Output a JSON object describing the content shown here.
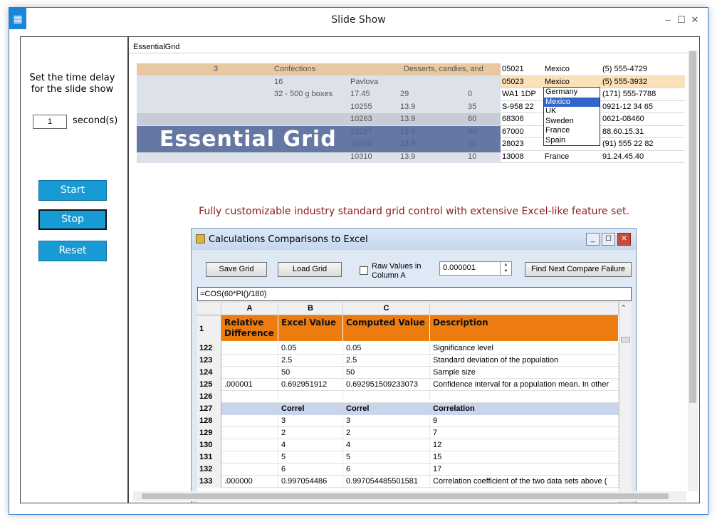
{
  "window": {
    "title": "Slide Show",
    "minimize": "–",
    "maximize": "☐",
    "close": "✕",
    "app_icon": "▦"
  },
  "left": {
    "delay_text": "Set the time delay for the slide show",
    "seconds_value": "1",
    "seconds_label": "second(s)",
    "start": "Start",
    "stop": "Stop",
    "reset": "Reset"
  },
  "content": {
    "tab_label": "EssentialGrid",
    "tagline": "Fully customizable industry standard grid control with extensive Excel-like feature set."
  },
  "banner": {
    "brand": "Essential Grid",
    "rows": [
      [
        "3",
        "Confections",
        "Desserts, candies, and"
      ],
      [
        "16",
        "Pavlova",
        ""
      ],
      [
        "32 - 500 g boxes",
        "17.45",
        "29",
        "0"
      ],
      [
        "10255",
        "13.9",
        "35"
      ],
      [
        "10263",
        "13.9",
        "60"
      ],
      [
        "10287",
        "13.9",
        "40"
      ],
      [
        "10296",
        "13.9",
        "30"
      ],
      [
        "10310",
        "13.9",
        "10"
      ]
    ],
    "country_rows": [
      [
        "05021",
        "Mexico",
        "(5) 555-4729"
      ],
      [
        "05023",
        "Mexico",
        "(5) 555-3932"
      ],
      [
        "WA1 1DP",
        "",
        "(171) 555-7788"
      ],
      [
        "S-958 22",
        "",
        "0921-12 34 65"
      ],
      [
        "68306",
        "",
        "0621-08460"
      ],
      [
        "67000",
        "",
        "88.60.15.31"
      ],
      [
        "28023",
        "",
        "(91) 555 22 82"
      ],
      [
        "13008",
        "France",
        "91.24.45.40"
      ]
    ],
    "dropdown": [
      "Germany",
      "Mexico",
      "UK",
      "Sweden",
      "France",
      "Spain"
    ]
  },
  "inner": {
    "title": "Calculations Comparisons to Excel",
    "save": "Save Grid",
    "load": "Load Grid",
    "raw": "Raw Values in Column A",
    "tolerance": "0.000001",
    "find": "Find Next Compare Failure",
    "formula": "=COS(60*PI()/180)",
    "cols": [
      "A",
      "B",
      "C"
    ],
    "headers": {
      "rownum": "1",
      "a": "Relative Difference",
      "b": "Excel Value",
      "c": "Computed Value",
      "d": "Description"
    },
    "rows": [
      {
        "n": "122",
        "a": "",
        "b": "0.05",
        "c": "0.05",
        "d": "Significance level"
      },
      {
        "n": "123",
        "a": "",
        "b": "2.5",
        "c": "2.5",
        "d": "Standard deviation of the population"
      },
      {
        "n": "124",
        "a": "",
        "b": "50",
        "c": "50",
        "d": "Sample size"
      },
      {
        "n": "125",
        "a": ".000001",
        "b": "0.692951912",
        "c": "0.692951509233073",
        "d": "Confidence interval for a population mean. In other"
      },
      {
        "n": "126",
        "a": "",
        "b": "",
        "c": "",
        "d": ""
      },
      {
        "n": "127",
        "a": "",
        "b": "Correl",
        "c": "Correl",
        "d": "Correlation"
      },
      {
        "n": "128",
        "a": "",
        "b": "3",
        "c": "3",
        "d": "9"
      },
      {
        "n": "129",
        "a": "",
        "b": "2",
        "c": "2",
        "d": "7"
      },
      {
        "n": "130",
        "a": "",
        "b": "4",
        "c": "4",
        "d": "12"
      },
      {
        "n": "131",
        "a": "",
        "b": "5",
        "c": "5",
        "d": "15"
      },
      {
        "n": "132",
        "a": "",
        "b": "6",
        "c": "6",
        "d": "17"
      },
      {
        "n": "133",
        "a": ".000000",
        "b": "0.997054486",
        "c": "0.997054485501581",
        "d": "Correlation coefficient of the two data sets above ("
      }
    ]
  }
}
